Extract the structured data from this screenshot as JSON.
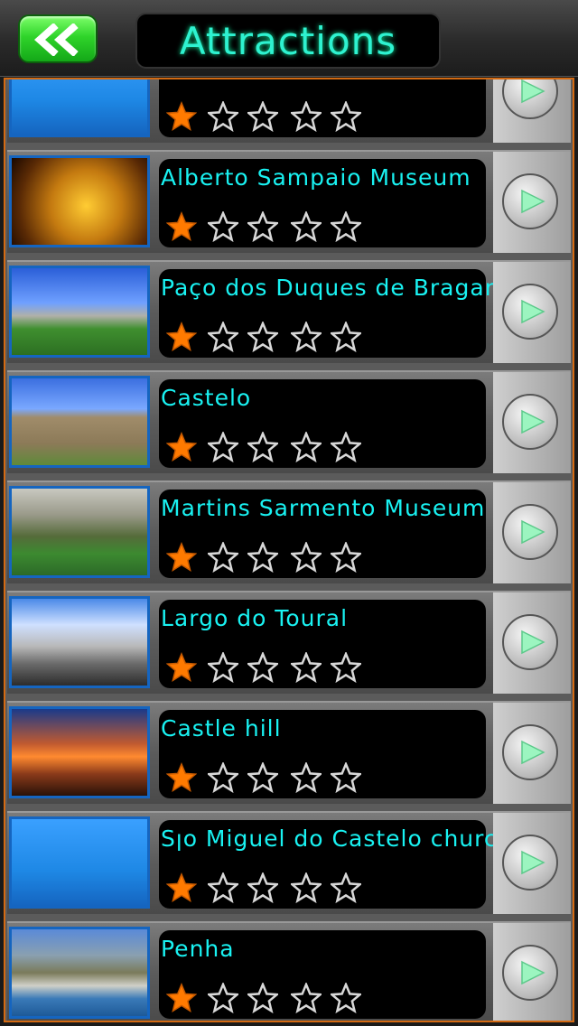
{
  "header": {
    "title": "Attractions",
    "back_icon": "double-chevron-left-icon"
  },
  "attractions": [
    {
      "name": "",
      "rating": 1,
      "thumb": "blue"
    },
    {
      "name": "Alberto Sampaio Museum",
      "rating": 1,
      "thumb": "gold-sculpture"
    },
    {
      "name": "Paço dos Duques de Bragança",
      "rating": 1,
      "thumb": "palace"
    },
    {
      "name": "Castelo",
      "rating": 1,
      "thumb": "castle"
    },
    {
      "name": "Martins Sarmento Museum",
      "rating": 1,
      "thumb": "garden-building"
    },
    {
      "name": "Largo do Toural",
      "rating": 1,
      "thumb": "plaza"
    },
    {
      "name": "Castle hill",
      "rating": 1,
      "thumb": "sunset-tower"
    },
    {
      "name": "Sןo Miguel do Castelo church",
      "rating": 1,
      "thumb": "blue"
    },
    {
      "name": "Penha",
      "rating": 1,
      "thumb": "hillside-town"
    }
  ],
  "colors": {
    "title": "#2ef2d0",
    "name": "#19f2f2",
    "star_filled": "#ff7a00",
    "border": "#d46a12"
  }
}
